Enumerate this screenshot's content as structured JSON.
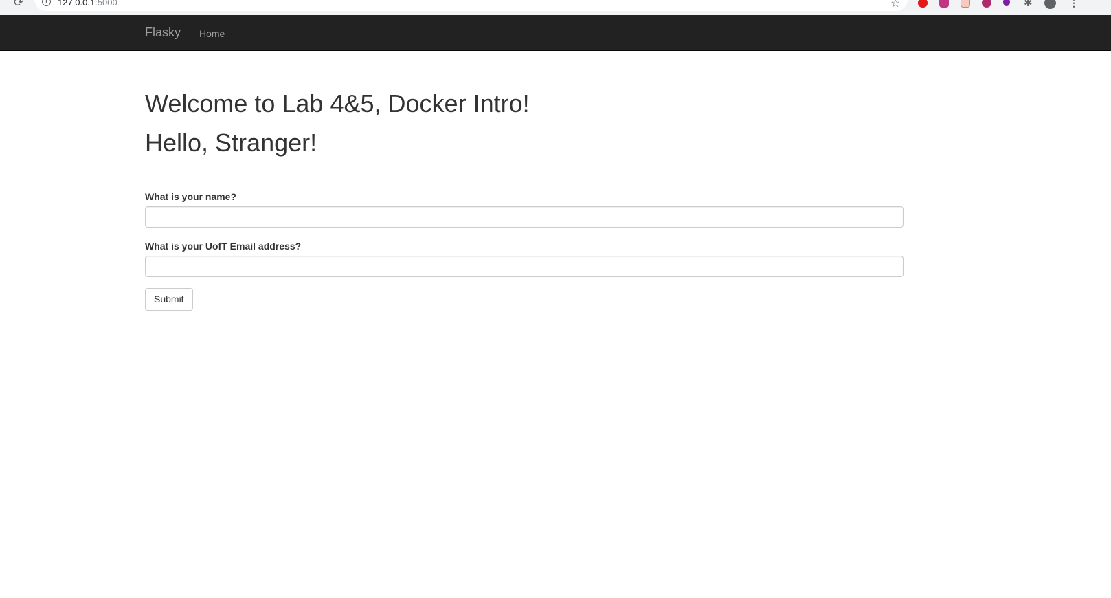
{
  "browser": {
    "url_host": "127.0.0.1",
    "url_port": ":5000",
    "icons": [
      "back-icon",
      "reload-icon",
      "info-icon",
      "star-icon",
      "extension-icon",
      "puzzle-icon",
      "profile-icon",
      "menu-icon"
    ],
    "reload_glyph": "⟳",
    "star_glyph": "☆",
    "info_glyph": "i",
    "menu_glyph": "⋮",
    "puzzle_glyph": "✱"
  },
  "navbar": {
    "brand": "Flasky",
    "links": [
      {
        "label": "Home"
      }
    ],
    "background": "#222222",
    "text_color": "#9d9d9d"
  },
  "main": {
    "welcome": "Welcome to Lab 4&5, Docker Intro!",
    "greeting": "Hello, Stranger!",
    "form": {
      "name_label": "What is your name?",
      "name_value": "",
      "email_label": "What is your UofT Email address?",
      "email_value": "",
      "submit_label": "Submit"
    }
  }
}
